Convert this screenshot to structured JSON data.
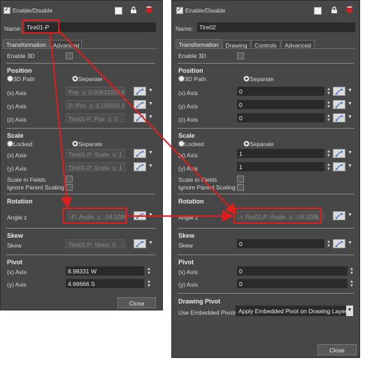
{
  "left": {
    "enable_label": "Enable/Disable",
    "name_label": "Name:",
    "name_value": "Tire01-P",
    "tabs": [
      "Transformation",
      "Advanced"
    ],
    "enable_3d": "Enable 3D",
    "position": {
      "title": "Position",
      "mode_a": "3D Path",
      "mode_b": "Separate",
      "x_label": "(x) Axis",
      "x_value": "Pos_x: 0.00833333-E",
      "y_label": "(y) Axis",
      "y_value": "P: Pos_y: 0.155555 N",
      "z_label": "(z) Axis",
      "z_value": "Tire01-P: Pos_z: 0"
    },
    "scale": {
      "title": "Scale",
      "mode_a": "Locked",
      "mode_b": "Separate",
      "x_label": "(x) Axis",
      "x_value": "Tire01-P: Scale_x: 1",
      "y_label": "(y) Axis",
      "y_value": "Tire01-P: Scale_y: 1",
      "fields": "Scale in Fields",
      "ignore": "Ignore Parent Scaling"
    },
    "rotation": {
      "title": "Rotation",
      "label": "Angle z",
      "value": "-P: Angle_z: -18.0288"
    },
    "skew": {
      "title": "Skew",
      "label": "Skew",
      "value": "Tire01-P: Skew: 0"
    },
    "pivot": {
      "title": "Pivot",
      "x_label": "(x) Axis",
      "x_value": "8.98331 W",
      "y_label": "(y) Axis",
      "y_value": "4.66666 S"
    },
    "close": "Close"
  },
  "right": {
    "enable_label": "Enable/Disable",
    "name_label": "Name:",
    "name_value": "Tire02",
    "tabs": [
      "Transformation",
      "Drawing",
      "Controls",
      "Advanced"
    ],
    "enable_3d": "Enable 3D",
    "position": {
      "title": "Position",
      "mode_a": "3D Path",
      "mode_b": "Separate",
      "x_label": "(x) Axis",
      "x_value": "0",
      "y_label": "(y) Axis",
      "y_value": "0",
      "z_label": "(z) Axis",
      "z_value": "0"
    },
    "scale": {
      "title": "Scale",
      "mode_a": "Locked",
      "mode_b": "Separate",
      "x_label": "(x) Axis",
      "x_value": "1",
      "y_label": "(y) Axis",
      "y_value": "1",
      "fields": "Scale in Fields",
      "ignore": "Ignore Parent Scaling"
    },
    "rotation": {
      "title": "Rotation",
      "label": "Angle z",
      "value": "+ Tire01-P: Angle_z: -18.0288"
    },
    "skew": {
      "title": "Skew",
      "label": "Skew",
      "value": "0"
    },
    "pivot": {
      "title": "Pivot",
      "x_label": "(x) Axis",
      "x_value": "0",
      "y_label": "(y) Axis",
      "y_value": "0"
    },
    "drawing_pivot": {
      "title": "Drawing Pivot",
      "label": "Use Embedded Pivots",
      "value": "Apply Embedded Pivot on Drawing Layer"
    },
    "close": "Close"
  },
  "colors": {
    "panel_bg": "#474747",
    "annotation": "#e21d1d",
    "field_bg": "#2a2a2a"
  },
  "icons": [
    "checkbox-icon",
    "white-square-icon",
    "lock-icon",
    "red-cylinder-icon",
    "function-curve-icon",
    "chevron-down-icon",
    "spin-arrows-icon"
  ]
}
